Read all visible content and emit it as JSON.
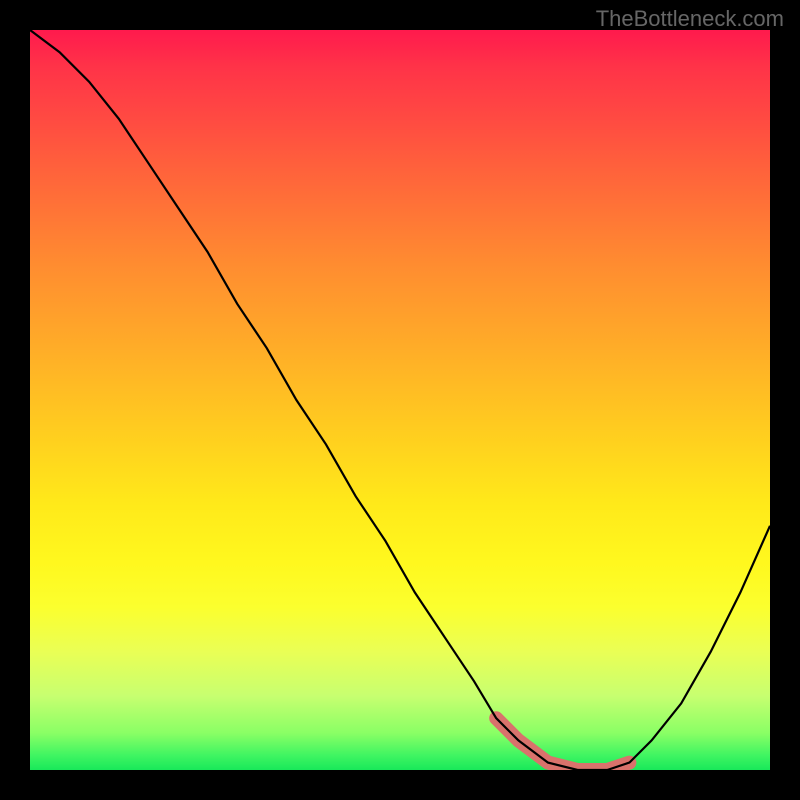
{
  "watermark": "TheBottleneck.com",
  "chart_data": {
    "type": "line",
    "title": "",
    "xlabel": "",
    "ylabel": "",
    "xlim": [
      0,
      100
    ],
    "ylim": [
      0,
      100
    ],
    "x": [
      0,
      4,
      8,
      12,
      16,
      20,
      24,
      28,
      32,
      36,
      40,
      44,
      48,
      52,
      56,
      60,
      63,
      66,
      70,
      74,
      78,
      81,
      84,
      88,
      92,
      96,
      100
    ],
    "values": [
      100,
      97,
      93,
      88,
      82,
      76,
      70,
      63,
      57,
      50,
      44,
      37,
      31,
      24,
      18,
      12,
      7,
      4,
      1,
      0,
      0,
      1,
      4,
      9,
      16,
      24,
      33
    ],
    "highlight_band": {
      "x_start": 61,
      "x_end": 83,
      "color": "#d9726c"
    },
    "gradient_stops": [
      {
        "pos": 0.0,
        "color": "#ff1a4d"
      },
      {
        "pos": 0.5,
        "color": "#ffd21e"
      },
      {
        "pos": 0.8,
        "color": "#fbff2e"
      },
      {
        "pos": 1.0,
        "color": "#18e85a"
      }
    ]
  }
}
